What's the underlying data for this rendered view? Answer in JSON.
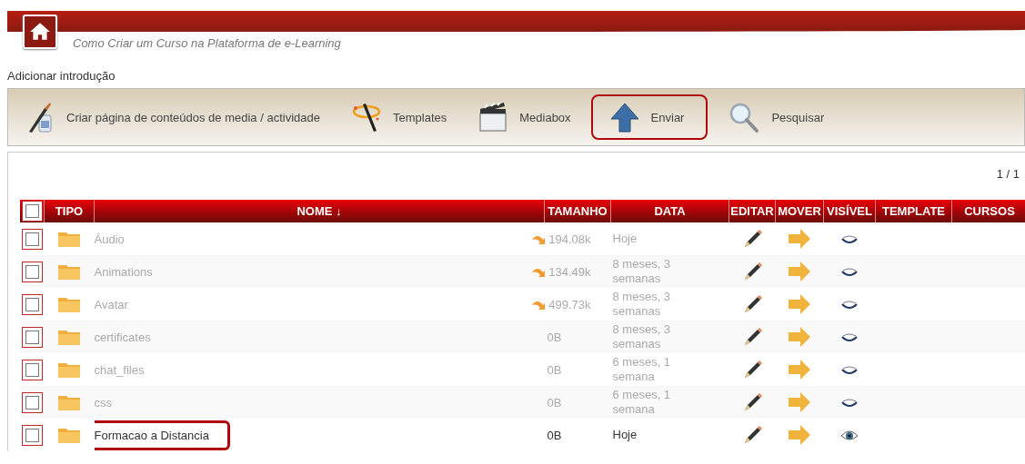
{
  "header": {
    "subtitle": "Como Criar um Curso na Plataforma de e-Learning"
  },
  "intro_link": "Adicionar introdução",
  "toolbar": [
    {
      "kind": "media",
      "label": "Criar página de conteúdos de media / actividade",
      "highlighted": false
    },
    {
      "kind": "templates",
      "label": "Templates",
      "highlighted": false
    },
    {
      "kind": "mediabox",
      "label": "Mediabox",
      "highlighted": false
    },
    {
      "kind": "upload",
      "label": "Enviar",
      "highlighted": true
    },
    {
      "kind": "search",
      "label": "Pesquisar",
      "highlighted": false
    }
  ],
  "pagination": "1 / 1",
  "table": {
    "select_all_checked": false,
    "columns": [
      "TIPO",
      "NOME ↓",
      "TAMANHO",
      "DATA",
      "EDITAR",
      "MOVER",
      "VISÍVEL",
      "TEMPLATE",
      "CURSOS"
    ],
    "rows": [
      {
        "name": "Áudio",
        "arrow": true,
        "size": "194.08k",
        "date": "Hoje",
        "visible": false,
        "checked": false,
        "highlighted": false
      },
      {
        "name": "Animations",
        "arrow": true,
        "size": "134.49k",
        "date": "8 meses, 3 semanas",
        "visible": false,
        "checked": false,
        "highlighted": false
      },
      {
        "name": "Avatar",
        "arrow": true,
        "size": "499.73k",
        "date": "8 meses, 3 semanas",
        "visible": false,
        "checked": false,
        "highlighted": false
      },
      {
        "name": "certificates",
        "arrow": false,
        "size": "0B",
        "date": "8 meses, 3 semanas",
        "visible": false,
        "checked": false,
        "highlighted": false
      },
      {
        "name": "chat_files",
        "arrow": false,
        "size": "0B",
        "date": "6 meses, 1 semana",
        "visible": false,
        "checked": false,
        "highlighted": false
      },
      {
        "name": "css",
        "arrow": false,
        "size": "0B",
        "date": "6 meses, 1 semana",
        "visible": false,
        "checked": false,
        "highlighted": false
      },
      {
        "name": "Formacao a Distancia",
        "arrow": false,
        "size": "0B",
        "date": "Hoje",
        "visible": true,
        "checked": false,
        "highlighted": true
      }
    ]
  }
}
